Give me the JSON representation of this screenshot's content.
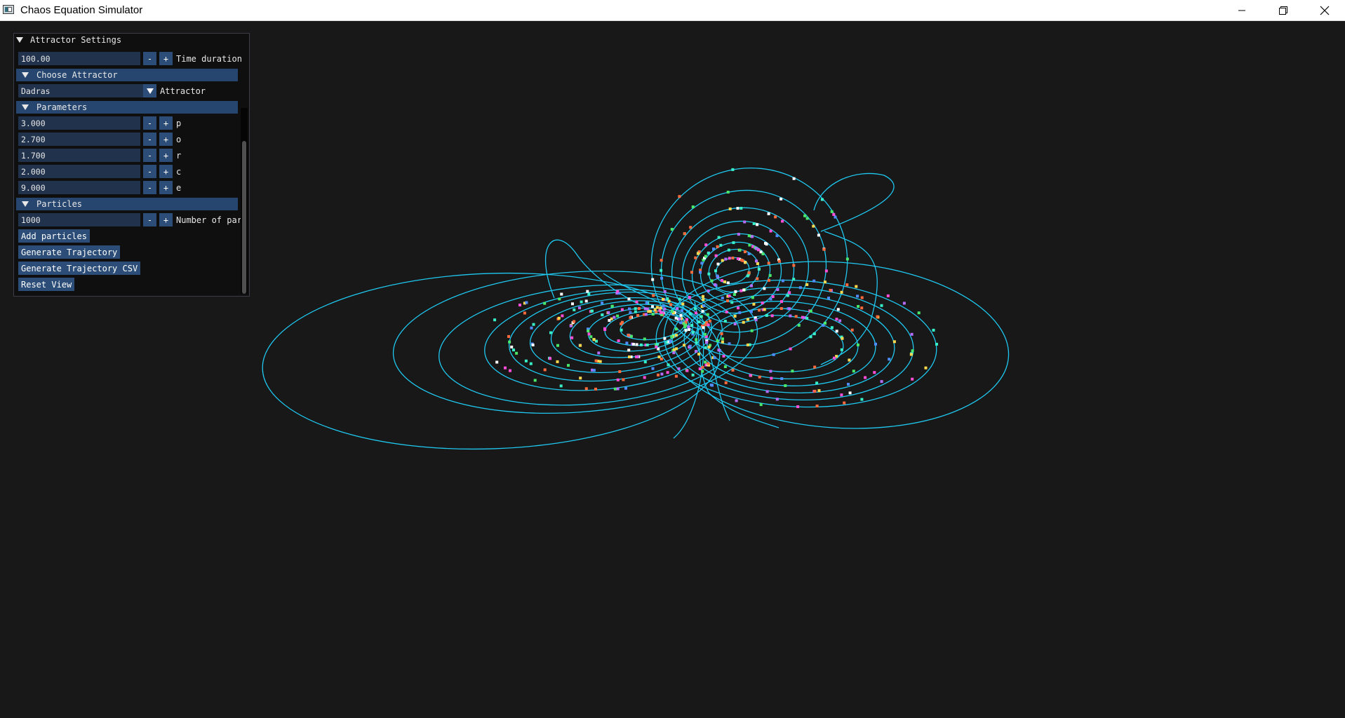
{
  "window": {
    "title": "Chaos Equation Simulator",
    "icon": "app-window-icon",
    "controls": [
      "minimize-icon",
      "restore-icon",
      "close-icon"
    ]
  },
  "panel": {
    "title": "Attractor Settings",
    "time_duration": {
      "value": "100.00",
      "label": "Time duration"
    },
    "steppers": {
      "minus": "-",
      "plus": "+"
    },
    "choose_attractor": {
      "header": "Choose Attractor",
      "selected": "Dadras",
      "label": "Attractor"
    },
    "parameters": {
      "header": "Parameters",
      "items": [
        {
          "value": "3.000",
          "label": "p"
        },
        {
          "value": "2.700",
          "label": "o"
        },
        {
          "value": "1.700",
          "label": "r"
        },
        {
          "value": "2.000",
          "label": "c"
        },
        {
          "value": "9.000",
          "label": "e"
        }
      ]
    },
    "particles": {
      "header": "Particles",
      "count": {
        "value": "1000",
        "label": "Number of par"
      },
      "buttons": {
        "add": "Add particles",
        "generate": "Generate Trajectory",
        "generate_csv": "Generate Trajectory CSV",
        "reset": "Reset View"
      }
    }
  },
  "colors": {
    "background": "#181818",
    "trajectory": "#1fc8f0",
    "header": "#26466f",
    "field": "#20324c",
    "button": "#2b4d78",
    "particles": [
      "#ff4fd8",
      "#49e86a",
      "#b66cff",
      "#ffd94d",
      "#4f8cff",
      "#ff6b3d",
      "#38f0c8",
      "#ffffff"
    ]
  },
  "particle_count": 1000
}
